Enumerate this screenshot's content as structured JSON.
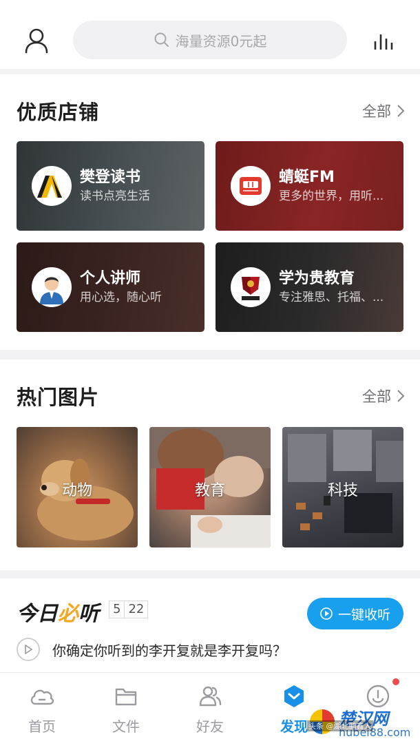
{
  "header": {
    "search_placeholder": "海量资源0元起"
  },
  "shops_section": {
    "title": "优质店铺",
    "more_label": "全部",
    "shops": [
      {
        "name": "樊登读书",
        "desc": "读书点亮生活"
      },
      {
        "name": "蜻蜓FM",
        "desc": "更多的世界，用听..."
      },
      {
        "name": "个人讲师",
        "desc": "用心选，随心听"
      },
      {
        "name": "学为贵教育",
        "desc": "专注雅思、托福、..."
      }
    ]
  },
  "pictures_section": {
    "title": "热门图片",
    "more_label": "全部",
    "items": [
      {
        "label": "动物"
      },
      {
        "label": "教育"
      },
      {
        "label": "科技"
      }
    ]
  },
  "daily_section": {
    "title_part1": "今日",
    "title_part2": "必",
    "title_part3": "听",
    "month": "5",
    "day": "22",
    "listen_button": "一键收听",
    "item_title": "你确定你听到的李开复就是李开复吗？"
  },
  "tabbar": {
    "tabs": [
      {
        "label": "首页",
        "icon": "cloud-icon",
        "active": false
      },
      {
        "label": "文件",
        "icon": "folder-icon",
        "active": false
      },
      {
        "label": "好友",
        "icon": "friends-icon",
        "active": false
      },
      {
        "label": "发现",
        "icon": "discover-icon",
        "active": true
      },
      {
        "label": "",
        "icon": "profile-icon",
        "active": false
      }
    ]
  },
  "watermark": {
    "title": "楚汉网",
    "url": "hubei88.com",
    "overlay_text": "头条 @湖北鹏鑫人"
  },
  "colors": {
    "accent": "#1890e8",
    "listen_button": "#18a0ee",
    "badge_red": "#f04a4a"
  }
}
